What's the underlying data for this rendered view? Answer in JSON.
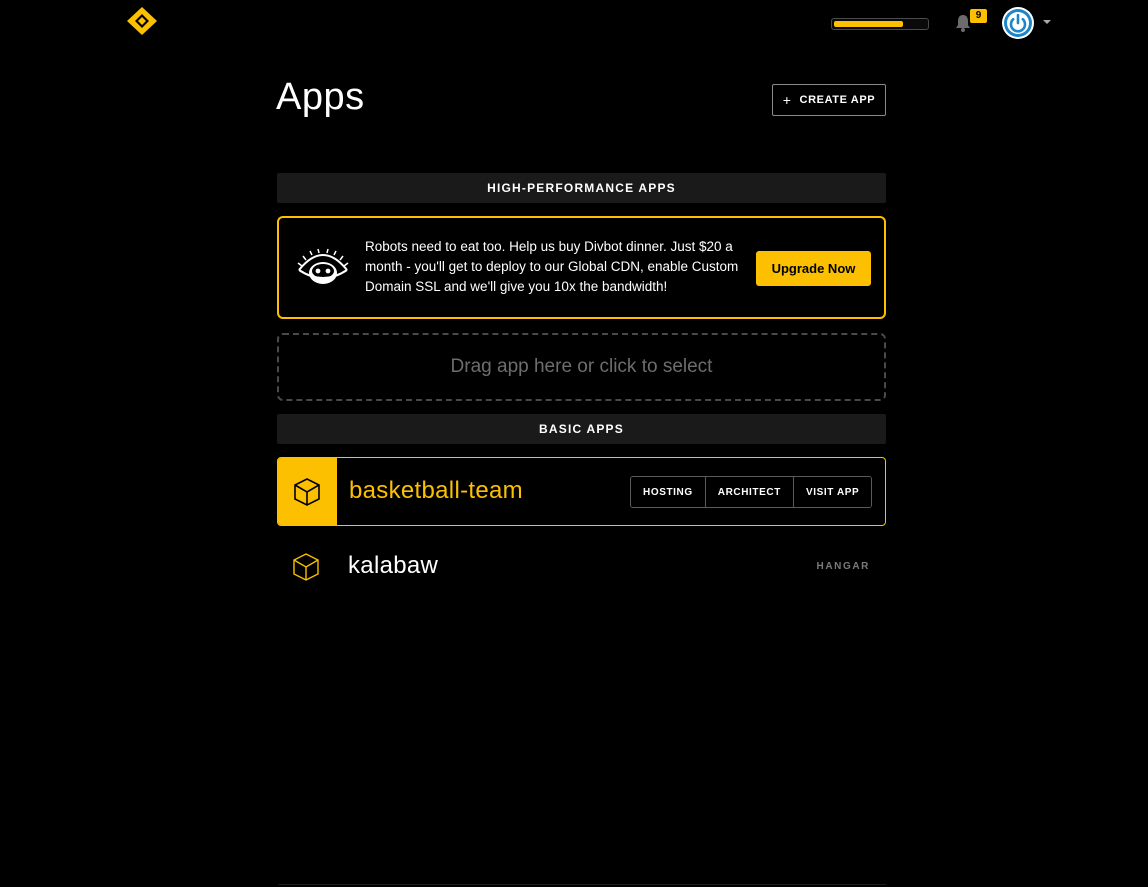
{
  "topbar": {
    "logo_icon": "diamond-logo-icon",
    "usage_progress": 0.75,
    "notification_count": "9",
    "notification_icon": "bell-icon",
    "avatar_icon": "power-icon",
    "accent_color": "#fcc000"
  },
  "header": {
    "title": "Apps",
    "create_label": "CREATE APP",
    "create_icon": "plus-icon"
  },
  "high_performance": {
    "heading": "HIGH-PERFORMANCE APPS",
    "promo_text": "Robots need to eat too. Help us buy Divbot dinner. Just $20 a month - you'll get to deploy to our Global CDN, enable Custom Domain SSL and we'll give you 10x the bandwidth!",
    "upgrade_label": "Upgrade Now",
    "mascot_icon": "divbot-robot-icon",
    "dropzone_text": "Drag app here or click to select"
  },
  "basic": {
    "heading": "BASIC APPS",
    "apps": [
      {
        "name": "basketball-team",
        "actions": [
          "HOSTING",
          "ARCHITECT",
          "VISIT APP"
        ],
        "icon": "cube-icon"
      },
      {
        "name": "kalabaw",
        "tag": "HANGAR",
        "icon": "cube-icon"
      }
    ]
  }
}
